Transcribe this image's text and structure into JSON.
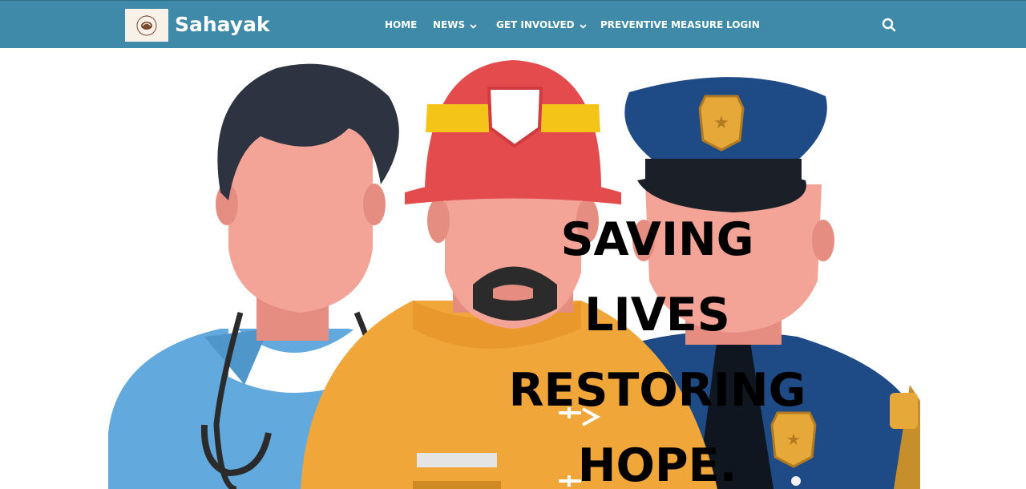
{
  "header": {
    "brand": "Sahayak",
    "logo_icon": "sahayak-logo",
    "nav": [
      {
        "label": "HOME",
        "has_dropdown": false
      },
      {
        "label": "NEWS",
        "has_dropdown": true
      },
      {
        "label": "GET INVOLVED",
        "has_dropdown": true
      },
      {
        "label": "PREVENTIVE MEASURE",
        "has_dropdown": false
      },
      {
        "label": "LOGIN",
        "has_dropdown": false
      }
    ],
    "search_icon": "search-icon"
  },
  "hero": {
    "lines": [
      "SAVING",
      "LIVES",
      "RESTORING",
      "HOPE."
    ],
    "image": "doctor-firefighter-police-illustration"
  },
  "colors": {
    "navbar": "#3f8aa8",
    "nav_text": "#ffffff",
    "hero_text": "#000000"
  }
}
